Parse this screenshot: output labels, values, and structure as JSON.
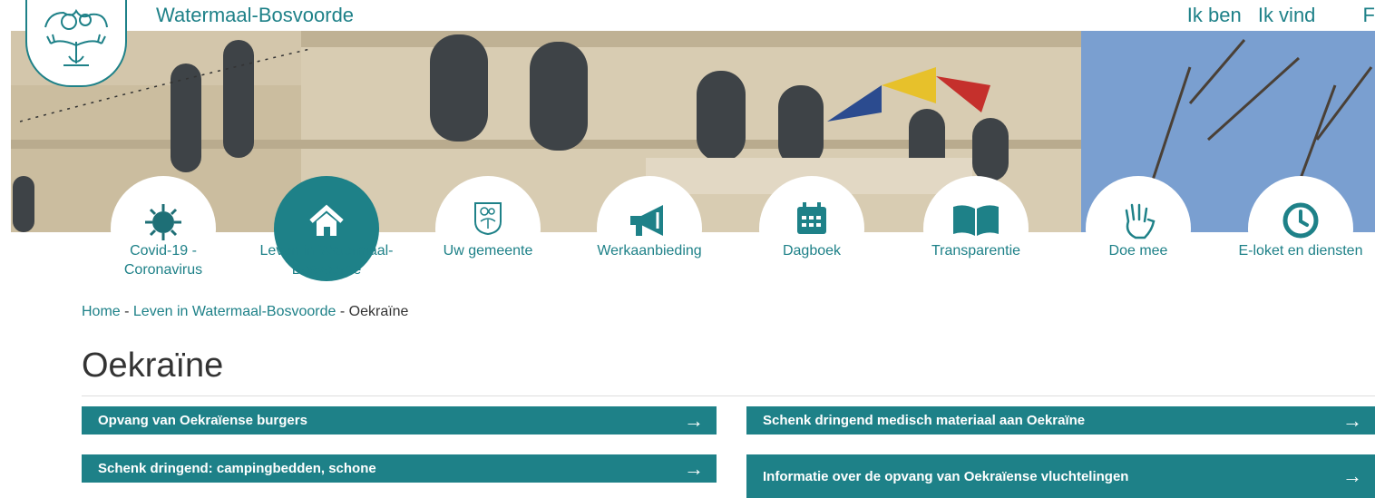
{
  "header": {
    "site_name": "Watermaal-Bosvoorde",
    "links": [
      "Ik ben",
      "Ik vind",
      "F"
    ]
  },
  "nav": [
    {
      "label": "Covid-19 - Coronavirus",
      "icon": "virus-icon"
    },
    {
      "label": "Leven in Watermaal-Bosvoorde",
      "icon": "home-icon",
      "active": true
    },
    {
      "label": "Uw gemeente",
      "icon": "municipal-crest-icon"
    },
    {
      "label": "Werkaanbieding",
      "icon": "megaphone-icon"
    },
    {
      "label": "Dagboek",
      "icon": "calendar-icon"
    },
    {
      "label": "Transparentie",
      "icon": "open-book-icon"
    },
    {
      "label": "Doe mee",
      "icon": "raised-hand-icon"
    },
    {
      "label": "E-loket en diensten",
      "icon": "clock-icon"
    }
  ],
  "breadcrumb": {
    "home": "Home",
    "sep1": " - ",
    "section": "Leven in Watermaal-Bosvoorde",
    "sep2": " - ",
    "current": "Oekraïne"
  },
  "page_title": "Oekraïne",
  "cards": [
    {
      "text": "Opvang van Oekraïense burgers",
      "arrow": "→"
    },
    {
      "text": "Schenk dringend medisch materiaal aan Oekraïne",
      "arrow": "→"
    },
    {
      "text": "Schenk dringend: campingbedden, schone",
      "arrow": "→"
    },
    {
      "text": "Informatie over de opvang van Oekraïense vluchtelingen",
      "arrow": "→"
    }
  ],
  "colors": {
    "accent": "#1e8188",
    "text": "#333333"
  }
}
